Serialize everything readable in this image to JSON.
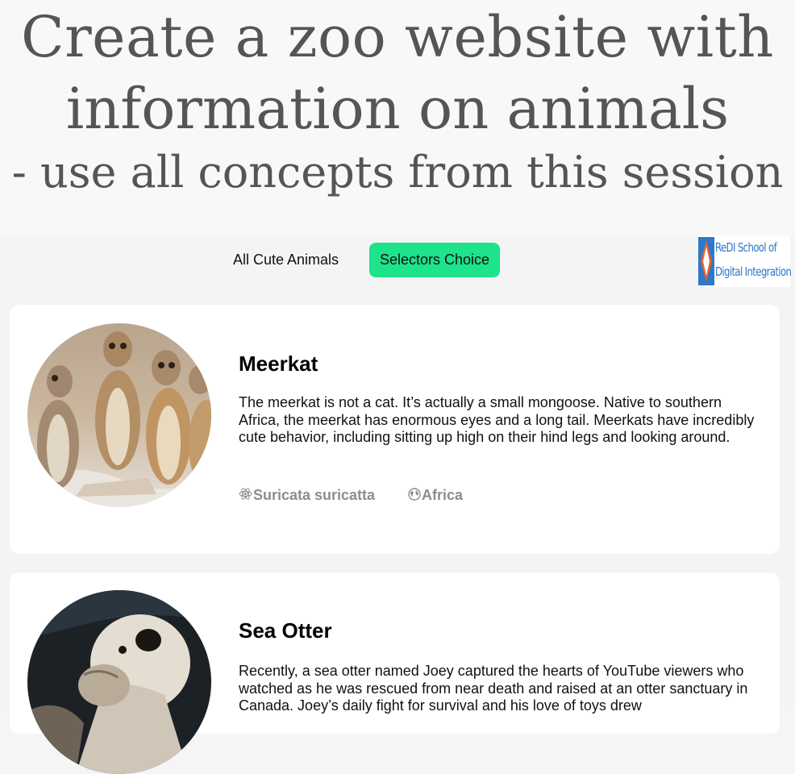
{
  "banner": {
    "line1": "Create a zoo website with",
    "line2": "information on animals",
    "line3": "- use all concepts from this session"
  },
  "nav": {
    "all_label": "All Cute Animals",
    "choice_label": "Selectors Choice",
    "active_color": "#1de38a"
  },
  "logo": {
    "line1": "ReDI School of",
    "line2": "Digital Integration",
    "brand_color": "#2d78c8",
    "accent_color": "#e8612c"
  },
  "animals": [
    {
      "name": "Meerkat",
      "description": "The meerkat is not a cat. It’s actually a small mongoose. Native to southern Africa, the meerkat has enormous eyes and a long tail. Meerkats have incredibly cute behavior, including sitting up high on their hind legs and looking around.",
      "scientific_name": "Suricata suricatta",
      "region": "Africa",
      "scientific_icon": "atom-icon",
      "region_icon": "globe-icon"
    },
    {
      "name": "Sea Otter",
      "description": "Recently, a sea otter named Joey captured the hearts of YouTube viewers who watched as he was rescued from near death and raised at an otter sanctuary in Canada. Joey’s daily fight for survival and his love of toys drew"
    }
  ]
}
